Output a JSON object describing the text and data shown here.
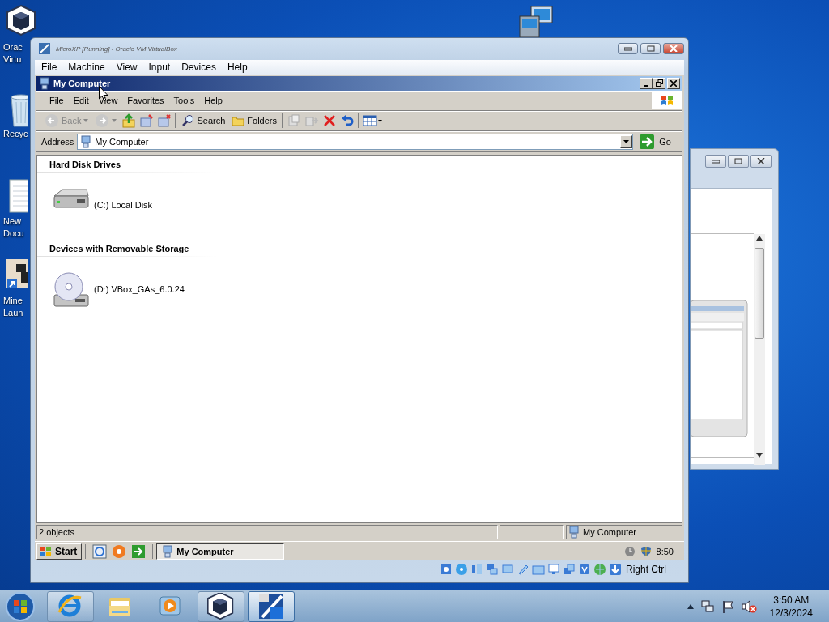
{
  "desktop": {
    "icons": [
      {
        "kind": "virtualbox",
        "lines": [
          "Orac",
          "Virtu"
        ]
      },
      {
        "kind": "recycle",
        "lines": [
          "Recyc"
        ]
      },
      {
        "kind": "document",
        "lines": [
          "New",
          "Docu"
        ]
      },
      {
        "kind": "launcher",
        "lines": [
          "Mine",
          "Laun"
        ]
      }
    ]
  },
  "vbox_window": {
    "title": "MicroXP [Running] - Oracle VM VirtualBox",
    "menu": [
      "File",
      "Machine",
      "View",
      "Input",
      "Devices",
      "Help"
    ],
    "status_bar": {
      "host_key": "Right Ctrl"
    }
  },
  "guest": {
    "window": {
      "title": "My Computer"
    },
    "menu": [
      "File",
      "Edit",
      "View",
      "Favorites",
      "Tools",
      "Help"
    ],
    "toolbar": {
      "back": "Back",
      "search": "Search",
      "folders": "Folders"
    },
    "address": {
      "label": "Address",
      "value": "My Computer",
      "go": "Go"
    },
    "groups": [
      {
        "title": "Hard Disk Drives",
        "items": [
          {
            "kind": "hdd",
            "label": "(C:) Local Disk"
          }
        ]
      },
      {
        "title": "Devices with Removable Storage",
        "items": [
          {
            "kind": "cd",
            "label": "(D:) VBox_GAs_6.0.24"
          }
        ]
      }
    ],
    "status_bar": {
      "count": "2 objects",
      "zone": "My Computer"
    },
    "taskbar": {
      "start": "Start",
      "tasks": [
        {
          "label": "My Computer",
          "selected": true
        }
      ],
      "clock": "8:50"
    }
  },
  "taskbar": {
    "pinned": [
      {
        "kind": "ie",
        "running": true,
        "selected": false
      },
      {
        "kind": "explorer",
        "running": false,
        "selected": false
      },
      {
        "kind": "media",
        "running": false,
        "selected": false
      },
      {
        "kind": "virtualbox",
        "running": true,
        "selected": false
      },
      {
        "kind": "xp",
        "running": true,
        "selected": true
      }
    ],
    "clock": {
      "time": "3:50 AM",
      "date": "12/3/2024"
    }
  }
}
